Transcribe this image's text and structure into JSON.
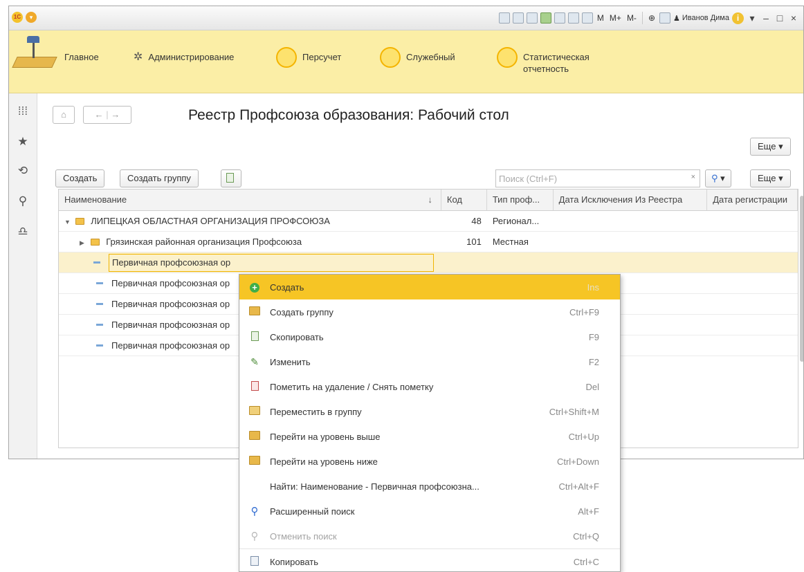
{
  "titlebar": {
    "logo": "1С",
    "mem_buttons": [
      "M",
      "M+",
      "M-"
    ],
    "user": "Иванов Дима"
  },
  "sections": [
    {
      "label": "Главное",
      "icon": "desk-lamp-logo"
    },
    {
      "label": "Администрирование",
      "icon": "gear-icon"
    },
    {
      "label": "Персучет",
      "icon": "yellow-circle-icon"
    },
    {
      "label": "Служебный",
      "icon": "yellow-circle-icon"
    },
    {
      "label": "Статистическая отчетность",
      "icon": "yellow-circle-icon"
    }
  ],
  "page": {
    "title": "Реестр Профсоюза образования: Рабочий стол",
    "more_top": "Еще",
    "nav_home": "⌂",
    "nav_back": "←",
    "nav_forward": "→"
  },
  "toolbar": {
    "create": "Создать",
    "create_group": "Создать группу",
    "search_placeholder": "Поиск (Ctrl+F)",
    "search_clear": "×",
    "more": "Еще"
  },
  "table": {
    "columns": [
      "Наименование",
      "Код",
      "Тип проф...",
      "Дата Исключения Из Реестра",
      "Дата регистрации"
    ],
    "sort_indicator": "↓",
    "rows": [
      {
        "name": "ЛИПЕЦКАЯ ОБЛАСТНАЯ ОРГАНИЗАЦИЯ ПРОФСОЮЗА",
        "code": "48",
        "type": "Регионал...",
        "excl": "",
        "reg": ""
      },
      {
        "name": "Грязинская районная организация Профсоюза",
        "code": "101",
        "type": "Местная",
        "excl": "",
        "reg": ""
      },
      {
        "name": "Первичная профсоюзная ор",
        "code": "",
        "type": "",
        "excl": "",
        "reg": ""
      },
      {
        "name": "Первичная профсоюзная ор",
        "code": "",
        "type": "",
        "excl": "",
        "reg": ""
      },
      {
        "name": "Первичная профсоюзная ор",
        "code": "",
        "type": "",
        "excl": "",
        "reg": ""
      },
      {
        "name": "Первичная профсоюзная ор",
        "code": "",
        "type": "",
        "excl": "",
        "reg": ""
      },
      {
        "name": "Первичная профсоюзная ор",
        "code": "",
        "type": "",
        "excl": "",
        "reg": ""
      }
    ]
  },
  "context_menu": [
    {
      "label": "Создать",
      "shortcut": "Ins",
      "icon": "plus-icon"
    },
    {
      "label": "Создать группу",
      "shortcut": "Ctrl+F9",
      "icon": "folder-add-icon"
    },
    {
      "label": "Скопировать",
      "shortcut": "F9",
      "icon": "copy-doc-icon"
    },
    {
      "label": "Изменить",
      "shortcut": "F2",
      "icon": "pencil-icon"
    },
    {
      "label": "Пометить на удаление / Снять пометку",
      "shortcut": "Del",
      "icon": "delete-mark-icon"
    },
    {
      "label": "Переместить в группу",
      "shortcut": "Ctrl+Shift+M",
      "icon": "move-to-group-icon"
    },
    {
      "label": "Перейти на уровень выше",
      "shortcut": "Ctrl+Up",
      "icon": "level-up-icon"
    },
    {
      "label": "Перейти на уровень ниже",
      "shortcut": "Ctrl+Down",
      "icon": "level-down-icon"
    },
    {
      "label": "Найти: Наименование - Первичная профсоюзна...",
      "shortcut": "Ctrl+Alt+F",
      "icon": ""
    },
    {
      "label": "Расширенный поиск",
      "shortcut": "Alt+F",
      "icon": "advanced-search-icon"
    },
    {
      "label": "Отменить поиск",
      "shortcut": "Ctrl+Q",
      "icon": "cancel-search-icon"
    },
    {
      "label": "Копировать",
      "shortcut": "Ctrl+C",
      "icon": "copy-clipboard-icon"
    }
  ],
  "colors": {
    "section_bar": "#fbeea6",
    "menu_highlight": "#f6c525",
    "selected_row": "#fbf1cc"
  }
}
